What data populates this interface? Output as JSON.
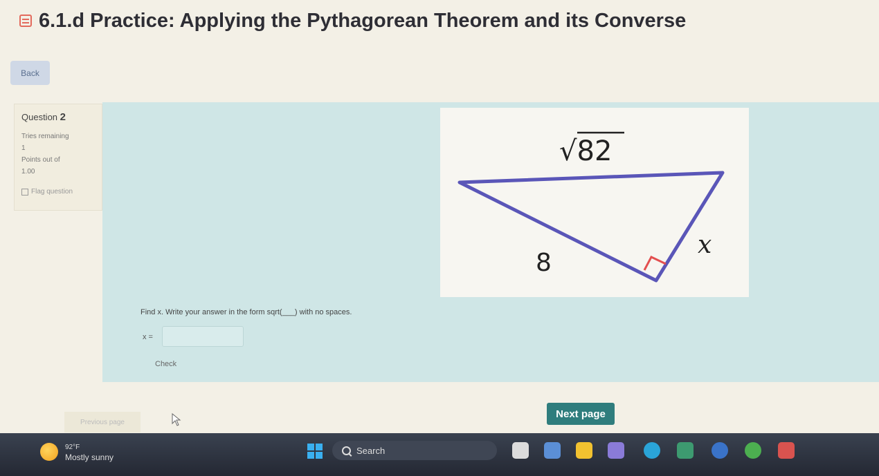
{
  "header": {
    "title": "6.1.d Practice: Applying the Pythagorean Theorem and its Converse"
  },
  "nav": {
    "back_label": "Back"
  },
  "question_info": {
    "label": "Question",
    "number": "2",
    "tries_label": "Tries remaining",
    "tries_value": "1",
    "points_label": "Points out of",
    "points_value": "1.00",
    "flag_label": "Flag question"
  },
  "figure": {
    "hypotenuse_label": "√82",
    "leg_label": "8",
    "unknown_label": "x"
  },
  "question": {
    "prompt": "Find x. Write your answer in the form sqrt(___) with no spaces.",
    "answer_label": "x =",
    "answer_value": "",
    "check_label": "Check"
  },
  "footer": {
    "previous_label": "Previous page",
    "next_label": "Next page"
  },
  "taskbar": {
    "temperature": "92°F",
    "condition": "Mostly sunny",
    "search_label": "Search"
  },
  "colors": {
    "content_bg": "#cfe6e6",
    "next_button": "#2f7d7d",
    "accent_red": "#e36a5c"
  }
}
